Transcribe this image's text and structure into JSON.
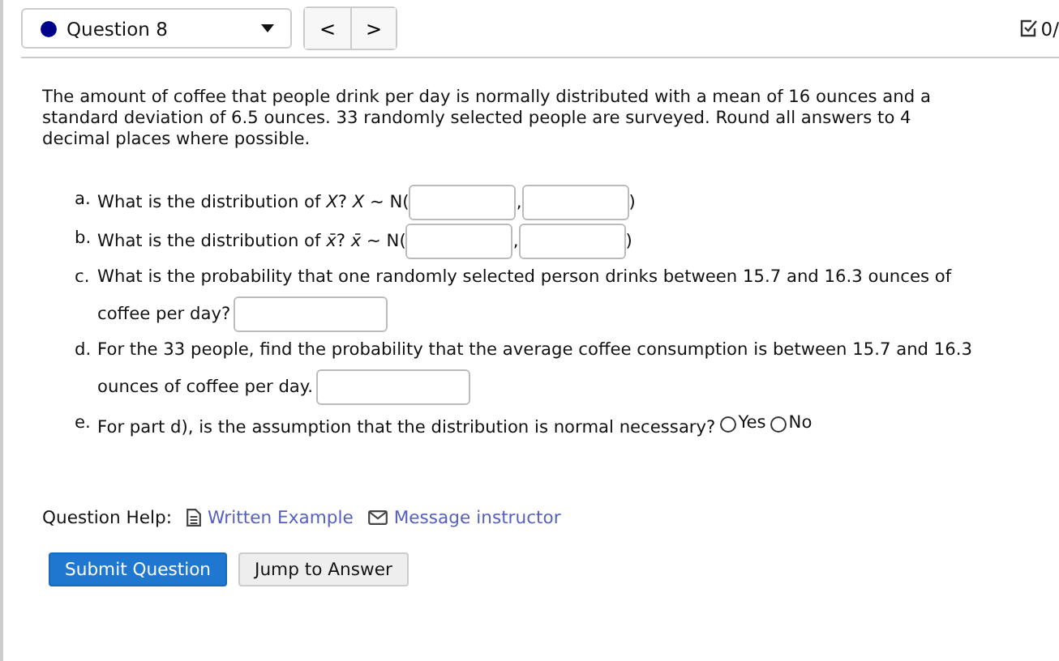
{
  "header": {
    "question_select": {
      "label": "Question 8",
      "color": "#00008b"
    },
    "prev": "<",
    "next": ">",
    "score": "0/"
  },
  "intro": "The amount of coffee that people drink per day is normally distributed with a mean of 16 ounces and a standard deviation of 6.5 ounces. 33 randomly selected people are surveyed. Round all answers to 4 decimal places where possible.",
  "parts": [
    {
      "letter": "a.",
      "segments": [
        {
          "kind": "text",
          "text": "What is the distribution of *X*? *X* ~ N("
        },
        {
          "kind": "field"
        },
        {
          "kind": "text",
          "text": ","
        },
        {
          "kind": "field"
        },
        {
          "kind": "text",
          "text": ")"
        }
      ]
    },
    {
      "letter": "b.",
      "segments": [
        {
          "kind": "text",
          "text": "What is the distribution of *x̄*? *x̄* ~ N("
        },
        {
          "kind": "field"
        },
        {
          "kind": "text",
          "text": ","
        },
        {
          "kind": "field"
        },
        {
          "kind": "text",
          "text": ")"
        }
      ]
    },
    {
      "letter": "c.",
      "segments": [
        {
          "kind": "text",
          "text": "What is the probability that one randomly selected person drinks between 15.7 and 16.3 ounces of"
        },
        {
          "kind": "text",
          "text": "coffee per day?"
        },
        {
          "kind": "field"
        }
      ]
    },
    {
      "letter": "d.",
      "segments": [
        {
          "kind": "text",
          "text": "For the 33 people, find the probability that the average coffee consumption is between 15.7 and 16.3"
        },
        {
          "kind": "text",
          "text": "ounces of coffee per day."
        },
        {
          "kind": "field"
        }
      ]
    },
    {
      "letter": "e.",
      "segments": [
        {
          "kind": "text",
          "text": "For part d), is the assumption that the distribution is normal necessary?"
        },
        {
          "kind": "radio",
          "label": "Yes",
          "selected": false
        },
        {
          "kind": "radio",
          "label": "No",
          "selected": false
        }
      ]
    }
  ],
  "help": {
    "label": "Question Help:",
    "links": [
      {
        "kind": "document",
        "label": "Written Example"
      },
      {
        "kind": "message",
        "label": "Message instructor"
      }
    ]
  },
  "buttons": [
    {
      "label": "Submit Question",
      "kind": "primary"
    },
    {
      "label": "Jump to Answer",
      "kind": "secondary"
    }
  ]
}
